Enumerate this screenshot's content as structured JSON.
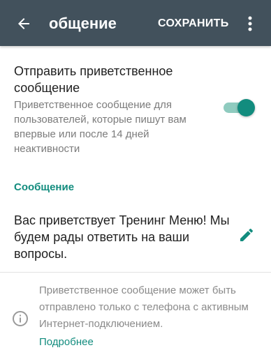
{
  "colors": {
    "appbar": "#42515c",
    "accent": "#128c7e",
    "toggle_track": "#8fcbbf"
  },
  "appbar": {
    "back_icon": "arrow-left-icon",
    "title": "общение",
    "save_label": "СОХРАНИТЬ",
    "menu_icon": "more-vert-icon"
  },
  "greeting_setting": {
    "title": "Отправить приветственное сообщение",
    "description": "Приветственное сообщение для пользователей, которые пишут вам впервые или после 14 дней неактивности",
    "enabled": true
  },
  "message_section": {
    "header": "Сообщение",
    "text": "Вас приветствует Тренинг Меню! Мы будем рады ответить на ваши вопросы.",
    "edit_icon": "pencil-icon"
  },
  "info": {
    "icon": "info-icon",
    "text": "Приветственное сообщение может быть отправлено только с телефона с активным Интернет-подключением.",
    "link": "Подробнее"
  }
}
